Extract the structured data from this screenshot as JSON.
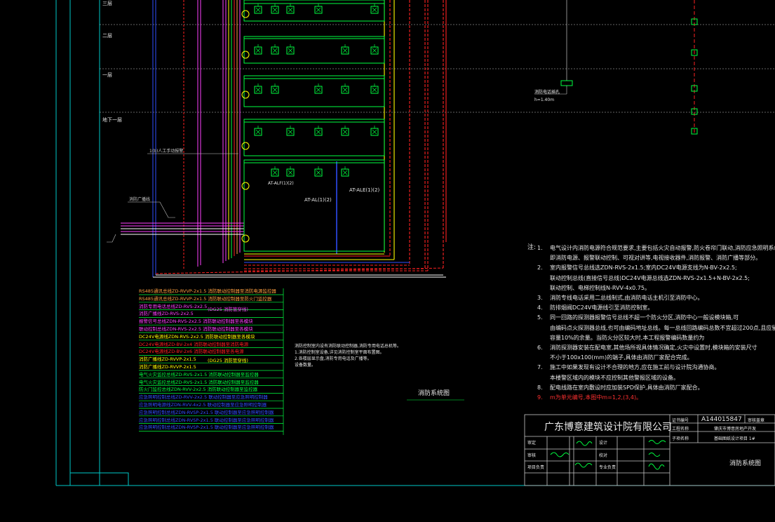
{
  "colors": {
    "background": "#000000",
    "frame": "#00c8c8",
    "bus_red": "#ff2020",
    "bus_yellow": "#ffff00",
    "bus_magenta": "#ff00ff",
    "bus_blue": "#3050ff",
    "device_green": "#00ff40",
    "text_white": "#e8e8e8",
    "notes_red": "#ff3030"
  },
  "floor_labels": [
    "二层",
    "一层",
    "地下一层"
  ],
  "drawing_title": "消防系统图",
  "notes": {
    "label": "注",
    "lines": [
      {
        "n": "1.",
        "text": "电气设计内消防电源符合规范要求,主要包括火灾自动报警,防火卷帘门联动,消防应急照明系统三个部分",
        "red": false
      },
      {
        "n": "",
        "text": "即消防电源、报警联动控制、可视对讲等,电视接收器件,消防报警、消防广播等部分。",
        "red": false
      },
      {
        "n": "2.",
        "text": "室内报警信号总线选ZDN-RVS-2x1.5;室内DC24V电源支线为N-BV-2x2.5;",
        "red": false
      },
      {
        "n": "",
        "text": "联动控制总线(直接信号总线)DC24V电源总线选ZDN-RVS-2x1.5+N-BV-2x2.5;",
        "red": false
      },
      {
        "n": "",
        "text": "联动控制、电梯控制线N-RVV-4x0.75。",
        "red": false
      },
      {
        "n": "3.",
        "text": "消防专线电话采用二总线制式,由消防电话主机引至消防中心。",
        "red": false
      },
      {
        "n": "4.",
        "text": "防排烟阀DC24V电源线引至消防控制室。",
        "red": false
      },
      {
        "n": "5.",
        "text": "同一回路的探测器报警信号总线不超一个防火分区,消防中心一般设模块箱,可",
        "red": false
      },
      {
        "n": "",
        "text": "由编码点火探测器总线,也可由编码地址总线。每一总线回路编码总数不宜超过200点,且应留有不小于额定",
        "red": false
      },
      {
        "n": "",
        "text": "容量10%的余量。当防火分区较大时,本工程报警编码数量约为",
        "red": false
      },
      {
        "n": "6.",
        "text": "消防探测器安装在配电室,其他场所视具体情况确定,火灾中设置时,模块箱的安装尺寸",
        "red": false
      },
      {
        "n": "",
        "text": "不小于100x100(mm)的端子,具体由消防厂家配合完成。",
        "red": false
      },
      {
        "n": "7.",
        "text": "施工中如果发现有设计不合理的地方,应在施工前与设计院沟通协商。",
        "red": false
      },
      {
        "n": "",
        "text": "本楼警区域内的模块不应控制其他警报区域的设备。",
        "red": false
      },
      {
        "n": "8.",
        "text": "配电线路在室内敷设时应加装SPD保护,具体由消防厂家配合。",
        "red": false
      },
      {
        "n": "9.",
        "text": "m为单元编号,本图中m=1,2,(3,4)。",
        "red": true
      }
    ]
  },
  "legend": [
    {
      "text": "RS485通讯总线ZD-RVVP-2x1.5 消防联动控制器至消防电源监控器",
      "color": "#ffa040"
    },
    {
      "text": "RS485通讯总线ZD-RVVP-2x1.5 消防联动控制器至防火门监控器",
      "color": "#ffa040"
    },
    {
      "text": "消防专用电话总线ZD-RVS-2x2.5",
      "color": "#ff40ff"
    },
    {
      "text": "消防广播线ZD-RVS-2x2.5",
      "color": "#ff40ff"
    },
    {
      "text": "报警信号总线ZDN-RVS-2x2.5 消防联动控制器至各模块",
      "color": "#ff40ff"
    },
    {
      "text": "联动控制总线ZDN-RVS-2x2.5 消防联动控制器至各模块",
      "color": "#ff40ff"
    },
    {
      "text": "DC24V电源线ZDN-RVS-2x2.5 消防联动控制器至各模块",
      "color": "#ffff00"
    },
    {
      "text": "DC24V电源线ZD-BV-2x4 消防联动控制器至消防电源",
      "color": "#ff2020"
    },
    {
      "text": "DC24V电源线ZD-BV-2x6 消防联动控制器至各电源",
      "color": "#ff2020"
    },
    {
      "text": "消防广播线ZD-RVVP-2x1.5",
      "color": "#ffff00"
    },
    {
      "text": "消防广播线ZD-RVVP-2x1.5",
      "color": "#ffff00"
    },
    {
      "text": "电气火灾监控总线ZD-RVS-2x1.5 消防联动控制器至监控器",
      "color": "#00ff40"
    },
    {
      "text": "电气火灾监控总线ZD-RVS-2x1.5 消防联动控制器至监控器",
      "color": "#00ff40"
    },
    {
      "text": "防火门监控总线ZDN-RVV-2x2.5 消防联动控制器至监控器",
      "color": "#00ff40"
    },
    {
      "text": "应急照明控制总线ZD-RVV-2x2.5 联动控制器至应急照明控制器",
      "color": "#3050ff"
    },
    {
      "text": "应急照明电源线ZDN-RVV-4x2.5 联动控制器至应急照明控制器",
      "color": "#3050ff"
    },
    {
      "text": "应急照明控制总线ZDN-RVSP-2x1.5 联动控制器至应急照明控制器",
      "color": "#3050ff"
    },
    {
      "text": "应急照明控制总线ZDN-RVSP-2x1.5 联动控制器至应急照明控制器",
      "color": "#3050ff"
    },
    {
      "text": "应急照明控制总线ZDN-RVSP-2x1.5 联动控制器至应急照明控制器",
      "color": "#3050ff"
    }
  ],
  "legend_tags": [
    "(DG25 消防管穿线)",
    "(DG25 消防管穿线)"
  ],
  "mid_notes": [
    "消防控制室内设有消防联动控制器,消防专用电话总机等。",
    "1.消防控制室设备,详见消防控制室平面布置图。",
    "2.各楼层显示盘,消防专用电话及广播等。",
    "设备数量。"
  ],
  "callouts": {
    "left_callout": "消防广播线",
    "mid_callout": "1(b)人工手动报警",
    "device_at1": "AT-ALE(1)(2)",
    "device_at2": "AT-AL(1)(2)",
    "device_at3": "AT-ALF(1)(2)",
    "riser_label": "消防电话插孔",
    "riser_height": "h=1.40m"
  },
  "title_block": {
    "company": "广东博意建筑设计院有限公司",
    "code_label": "证书编号",
    "code_value": "A144015847",
    "project_label": "工程名称",
    "project_value": "肇庆市博意房地产开发",
    "sub_label": "子项名称",
    "sub_value": "基础图纸设计项目 1#",
    "drawing_label": "图名",
    "drawing_value": "消防系统图",
    "roles": [
      "审定",
      "审核",
      "项目负责",
      "设计",
      "校对",
      "专业负责"
    ],
    "corner_label": "审核盖章"
  }
}
